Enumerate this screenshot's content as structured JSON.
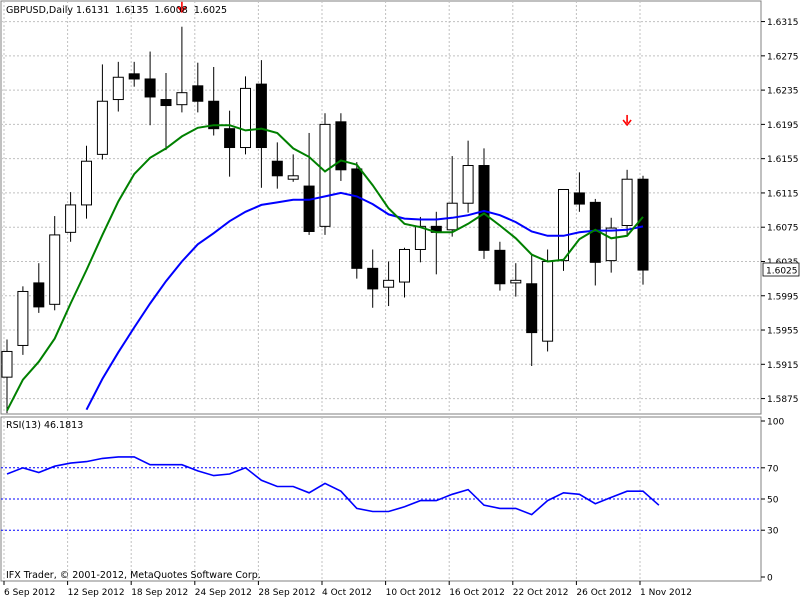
{
  "header": {
    "symbol": "GBPUSD,Daily",
    "ohlc": "1.6131  1.6135  1.6008  1.6025"
  },
  "rsi_header": "RSI(13) 46.1813",
  "copyright": "IFX Trader, © 2001-2012, MetaQuotes Software Corp.",
  "current_price_label": "1.6025",
  "colors": {
    "background": "#ffffff",
    "grid": "#c0c0c0",
    "bull_body": "#ffffff",
    "bear_body": "#000000",
    "ma_fast": "#008000",
    "ma_slow": "#0000ff",
    "rsi_line": "#0000ff",
    "rsi_level": "#0000ff",
    "arrow": "#ff0000"
  },
  "chart_data": [
    {
      "type": "candlestick",
      "title": "GBPUSD,Daily",
      "price_ylim": [
        1.5857,
        1.6339
      ],
      "yticks": [
        "1.6315",
        "1.6275",
        "1.6235",
        "1.6195",
        "1.6155",
        "1.6115",
        "1.6075",
        "1.6035",
        "1.5995",
        "1.5955",
        "1.5915",
        "1.5875"
      ],
      "yticks_values": [
        1.6315,
        1.6275,
        1.6235,
        1.6195,
        1.6155,
        1.6115,
        1.6075,
        1.6035,
        1.5995,
        1.5955,
        1.5915,
        1.5875
      ],
      "xticks": [
        "6 Sep 2012",
        "12 Sep 2012",
        "18 Sep 2012",
        "24 Sep 2012",
        "28 Sep 2012",
        "4 Oct 2012",
        "10 Oct 2012",
        "16 Oct 2012",
        "22 Oct 2012",
        "26 Oct 2012",
        "1 Nov 2012"
      ],
      "xticks_index": [
        0,
        4,
        8,
        12,
        16,
        20,
        24,
        28,
        32,
        36,
        40
      ],
      "candles": [
        {
          "o": 1.59,
          "h": 1.5944,
          "l": 1.5858,
          "c": 1.593
        },
        {
          "o": 1.5937,
          "h": 1.6006,
          "l": 1.5926,
          "c": 1.6
        },
        {
          "o": 1.601,
          "h": 1.6033,
          "l": 1.5975,
          "c": 1.5982
        },
        {
          "o": 1.5985,
          "h": 1.6088,
          "l": 1.5978,
          "c": 1.6066
        },
        {
          "o": 1.6069,
          "h": 1.6116,
          "l": 1.6058,
          "c": 1.6101
        },
        {
          "o": 1.6101,
          "h": 1.617,
          "l": 1.6085,
          "c": 1.6152
        },
        {
          "o": 1.616,
          "h": 1.6265,
          "l": 1.6154,
          "c": 1.6222
        },
        {
          "o": 1.6224,
          "h": 1.6268,
          "l": 1.621,
          "c": 1.625
        },
        {
          "o": 1.6254,
          "h": 1.6268,
          "l": 1.6239,
          "c": 1.6248
        },
        {
          "o": 1.6248,
          "h": 1.628,
          "l": 1.6194,
          "c": 1.6227
        },
        {
          "o": 1.6224,
          "h": 1.6255,
          "l": 1.6165,
          "c": 1.6217
        },
        {
          "o": 1.6218,
          "h": 1.6309,
          "l": 1.6209,
          "c": 1.6232
        },
        {
          "o": 1.624,
          "h": 1.6267,
          "l": 1.6209,
          "c": 1.6222
        },
        {
          "o": 1.6222,
          "h": 1.6262,
          "l": 1.6182,
          "c": 1.619
        },
        {
          "o": 1.619,
          "h": 1.6211,
          "l": 1.6134,
          "c": 1.6168
        },
        {
          "o": 1.6168,
          "h": 1.6251,
          "l": 1.616,
          "c": 1.6237
        },
        {
          "o": 1.6242,
          "h": 1.627,
          "l": 1.6121,
          "c": 1.6168
        },
        {
          "o": 1.6152,
          "h": 1.6174,
          "l": 1.612,
          "c": 1.6135
        },
        {
          "o": 1.6131,
          "h": 1.616,
          "l": 1.6128,
          "c": 1.6135
        },
        {
          "o": 1.6123,
          "h": 1.6185,
          "l": 1.6066,
          "c": 1.607
        },
        {
          "o": 1.6076,
          "h": 1.6208,
          "l": 1.6066,
          "c": 1.6195
        },
        {
          "o": 1.6198,
          "h": 1.6208,
          "l": 1.6129,
          "c": 1.6142
        },
        {
          "o": 1.6143,
          "h": 1.6151,
          "l": 1.6015,
          "c": 1.6027
        },
        {
          "o": 1.6027,
          "h": 1.6049,
          "l": 1.5981,
          "c": 1.6003
        },
        {
          "o": 1.6005,
          "h": 1.6035,
          "l": 1.5983,
          "c": 1.6013
        },
        {
          "o": 1.6011,
          "h": 1.6051,
          "l": 1.5993,
          "c": 1.6049
        },
        {
          "o": 1.6049,
          "h": 1.6087,
          "l": 1.6034,
          "c": 1.6076
        },
        {
          "o": 1.6076,
          "h": 1.6093,
          "l": 1.602,
          "c": 1.6069
        },
        {
          "o": 1.6072,
          "h": 1.6158,
          "l": 1.6064,
          "c": 1.6103
        },
        {
          "o": 1.6103,
          "h": 1.6176,
          "l": 1.6092,
          "c": 1.6147
        },
        {
          "o": 1.6147,
          "h": 1.6167,
          "l": 1.6038,
          "c": 1.6048
        },
        {
          "o": 1.6048,
          "h": 1.6058,
          "l": 1.6001,
          "c": 1.6009
        },
        {
          "o": 1.601,
          "h": 1.6033,
          "l": 1.5994,
          "c": 1.6013
        },
        {
          "o": 1.6009,
          "h": 1.6044,
          "l": 1.5913,
          "c": 1.5952
        },
        {
          "o": 1.5942,
          "h": 1.6049,
          "l": 1.593,
          "c": 1.6035
        },
        {
          "o": 1.6036,
          "h": 1.6117,
          "l": 1.6024,
          "c": 1.6119
        },
        {
          "o": 1.6115,
          "h": 1.6139,
          "l": 1.6093,
          "c": 1.6102
        },
        {
          "o": 1.6104,
          "h": 1.6108,
          "l": 1.6007,
          "c": 1.6034
        },
        {
          "o": 1.6036,
          "h": 1.6086,
          "l": 1.6022,
          "c": 1.6074
        },
        {
          "o": 1.6077,
          "h": 1.6142,
          "l": 1.6065,
          "c": 1.6131
        },
        {
          "o": 1.6131,
          "h": 1.6135,
          "l": 1.6008,
          "c": 1.6025
        }
      ],
      "ma_fast": [
        1.5861,
        1.5897,
        1.5918,
        1.5945,
        1.5986,
        1.6025,
        1.6066,
        1.6105,
        1.6137,
        1.6156,
        1.6167,
        1.6181,
        1.6191,
        1.6194,
        1.6194,
        1.6188,
        1.619,
        1.6185,
        1.6167,
        1.6157,
        1.614,
        1.6153,
        1.6148,
        1.6124,
        1.6097,
        1.6079,
        1.6075,
        1.6069,
        1.6069,
        1.6079,
        1.6091,
        1.6077,
        1.6062,
        1.6043,
        1.6035,
        1.6037,
        1.6061,
        1.6072,
        1.6062,
        1.6065,
        1.6087
      ],
      "ma_slow": [
        null,
        null,
        null,
        null,
        null,
        1.5862,
        1.5898,
        1.5929,
        1.5958,
        1.5986,
        1.6012,
        1.6035,
        1.6055,
        1.6068,
        1.6082,
        1.6093,
        1.6101,
        1.6104,
        1.6107,
        1.6107,
        1.6111,
        1.6115,
        1.6111,
        1.6102,
        1.609,
        1.6085,
        1.6084,
        1.6084,
        1.6086,
        1.6089,
        1.6094,
        1.6089,
        1.6081,
        1.607,
        1.6065,
        1.6065,
        1.6069,
        1.6071,
        1.6071,
        1.6072,
        1.6076
      ],
      "arrows": [
        {
          "index": 11,
          "price": 1.6331
        },
        {
          "index": 39,
          "price": 1.6199
        }
      ]
    },
    {
      "type": "line",
      "title": "RSI(13) 46.1813",
      "ylim": [
        0,
        100
      ],
      "yticks": [
        "100",
        "70",
        "50",
        "30",
        "0"
      ],
      "yticks_values": [
        100,
        70,
        50,
        30,
        0
      ],
      "levels": [
        70,
        50,
        30
      ],
      "values": [
        66,
        70,
        67,
        71,
        73,
        74,
        76,
        77,
        77,
        72,
        72,
        72,
        68,
        65,
        66,
        70,
        62,
        58,
        58,
        54,
        60,
        55,
        44,
        42,
        42,
        45,
        49,
        49,
        53,
        56,
        46,
        44,
        44,
        40,
        49,
        54,
        53,
        47,
        51,
        55,
        55,
        46
      ]
    }
  ]
}
